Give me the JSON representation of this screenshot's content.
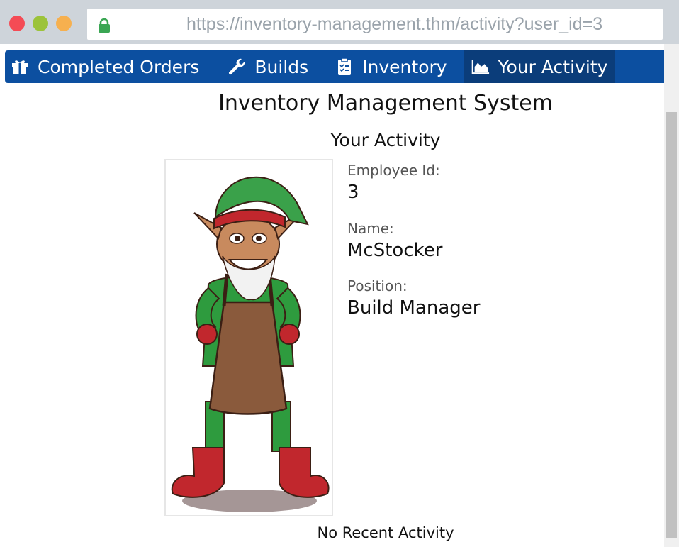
{
  "browser": {
    "url": "https://inventory-management.thm/activity?user_id=3"
  },
  "nav": {
    "items": [
      {
        "label": "Completed Orders",
        "icon": "gift-icon"
      },
      {
        "label": "Builds",
        "icon": "wrench-icon"
      },
      {
        "label": "Inventory",
        "icon": "clipboard-icon"
      },
      {
        "label": "Your Activity",
        "icon": "area-chart-icon"
      }
    ],
    "active_index": 3,
    "color": "#0c4fa0",
    "active_color": "#0b3d7a"
  },
  "page": {
    "title": "Inventory Management System",
    "section_title": "Your Activity"
  },
  "profile": {
    "employee_id_label": "Employee Id:",
    "employee_id": "3",
    "name_label": "Name:",
    "name": "McStocker",
    "position_label": "Position:",
    "position": "Build Manager"
  },
  "activity": {
    "empty_message": "No Recent Activity"
  }
}
